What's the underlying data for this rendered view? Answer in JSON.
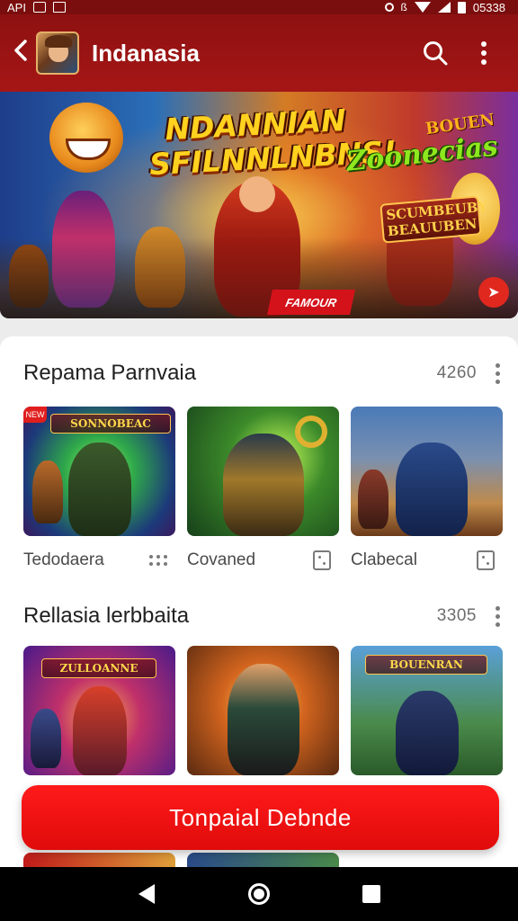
{
  "status_bar": {
    "left_text": "API",
    "time": "05338"
  },
  "app_bar": {
    "title": "Indanasia"
  },
  "hero": {
    "title": "NDANNIAN SFILNNLNBNS!",
    "sub1": "BOUEN",
    "sub2": "Zoonecias",
    "sub3": "SCUMBEUBY BEAUUBEN",
    "tag": "FAMOUR"
  },
  "sections": [
    {
      "title": "Repama Parnvaia",
      "count": "4260",
      "items": [
        {
          "label": "Tedodaera",
          "icon": "grid-icon",
          "badge": "NEW",
          "card_title": "SONNOBEAC"
        },
        {
          "label": "Covaned",
          "icon": "dice-icon"
        },
        {
          "label": "Clabecal",
          "icon": "dice-icon"
        }
      ]
    },
    {
      "title": "Rellasia lerbbaita",
      "count": "3305",
      "items": [
        {
          "card_title": "ZULLOANNE"
        },
        {
          "card_title": ""
        },
        {
          "card_title": "BOUENRAN"
        }
      ]
    }
  ],
  "cta": {
    "label": "Tonpaial Debnde"
  },
  "colors": {
    "primary": "#a51616",
    "cta": "#ff1a1a"
  }
}
